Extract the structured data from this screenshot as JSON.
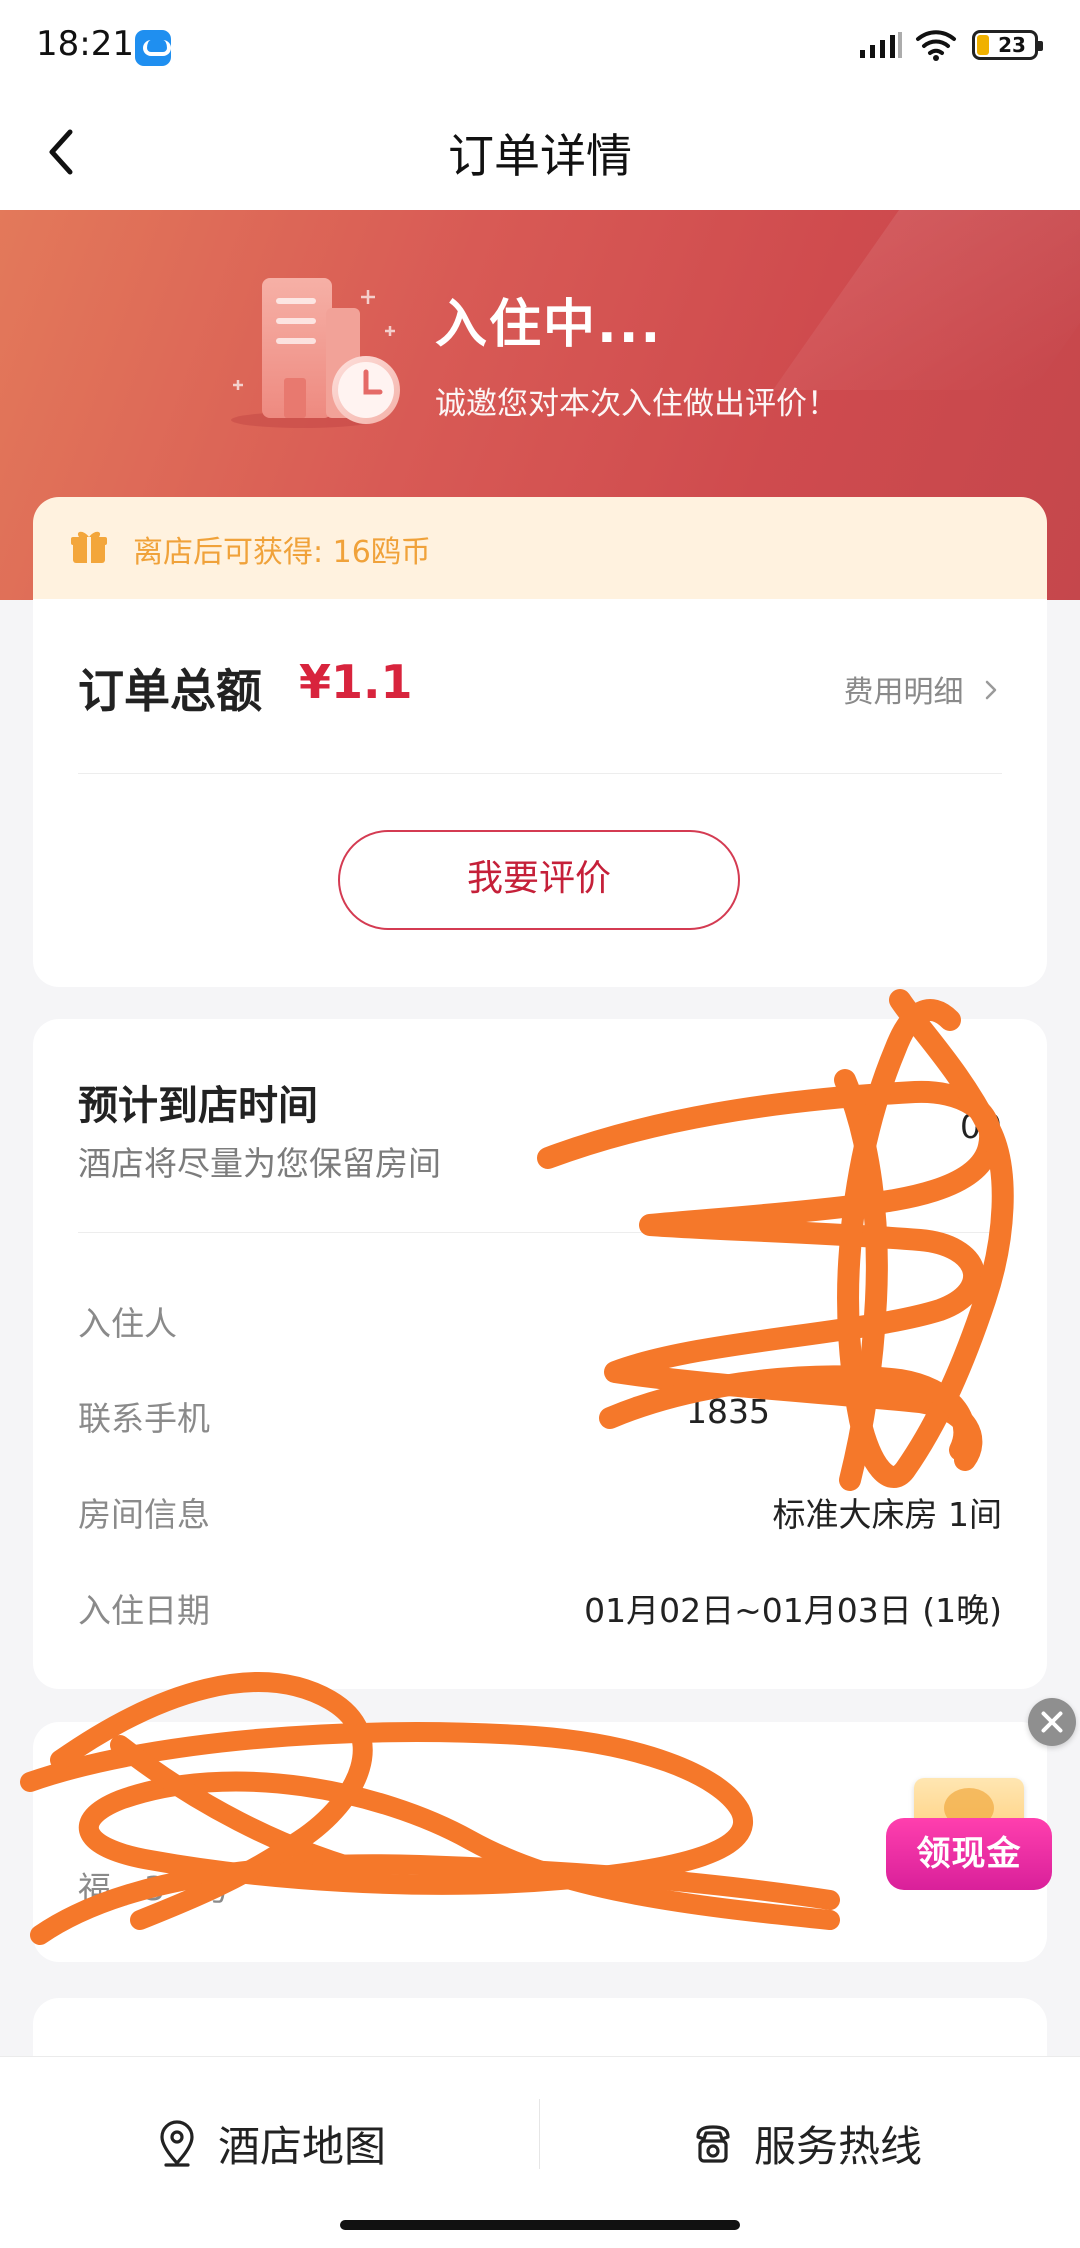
{
  "status_bar": {
    "time": "18:21",
    "battery_level": "23"
  },
  "nav": {
    "title": "订单详情"
  },
  "hero": {
    "title": "入住中...",
    "subtitle": "诚邀您对本次入住做出评价！"
  },
  "reward": {
    "text": "离店后可获得: 16鸥币"
  },
  "order_total": {
    "label": "订单总额",
    "amount": "¥1.1",
    "fee_detail_label": "费用明细",
    "review_button_label": "我要评价"
  },
  "arrival": {
    "title": "预计到店时间",
    "subtitle": "酒店将尽量为您保留房间",
    "value_visible": "00"
  },
  "info_rows": [
    {
      "label": "入住人",
      "value": ""
    },
    {
      "label": "联系手机",
      "value": "1835"
    },
    {
      "label": "房间信息",
      "value": "标准大床房 1间"
    },
    {
      "label": "入住日期",
      "value": "01月02日~01月03日 (1晚)"
    }
  ],
  "hotel": {
    "name": "",
    "address": "福…3-2号"
  },
  "floating_widget": {
    "label": "领现金"
  },
  "bottom_bar": {
    "map_label": "酒店地图",
    "hotline_label": "服务热线"
  },
  "colors": {
    "accent_red": "#d8243d",
    "hero_gradient_start": "#e3795a",
    "hero_gradient_end": "#c5474c",
    "reward_bg": "#fff2df",
    "reward_text": "#f0a23a",
    "scribble": "#f5782a"
  }
}
